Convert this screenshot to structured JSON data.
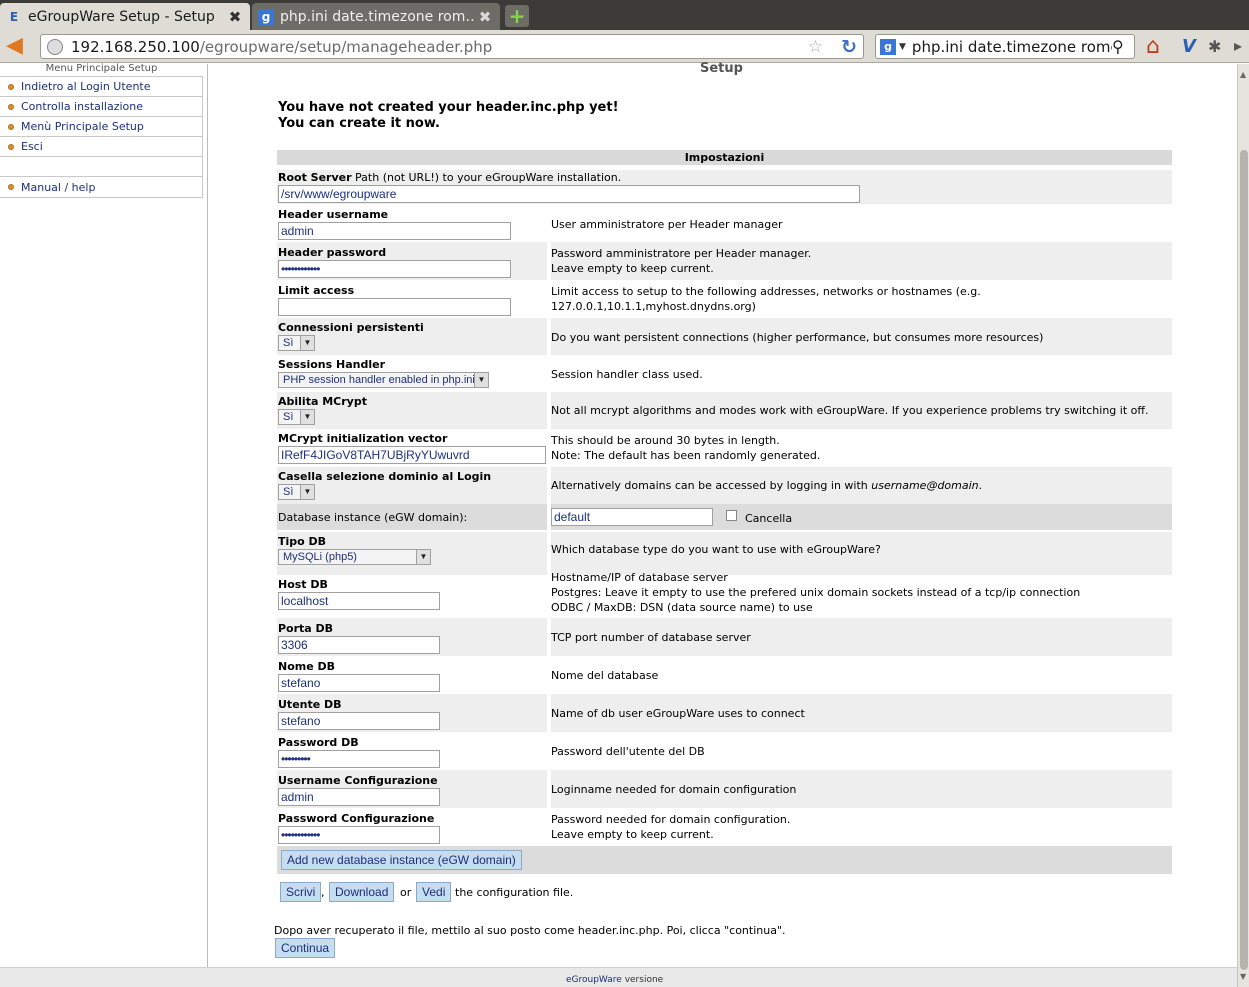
{
  "browser": {
    "tabs": [
      {
        "label": "eGroupWare Setup - Setup",
        "active": true,
        "favicon": "egroupware-icon"
      },
      {
        "label": "php.ini date.timezone rom…",
        "active": false,
        "favicon": "google-icon"
      }
    ],
    "url_host": "192.168.250.100",
    "url_path": "/egroupware/setup/manageheader.php",
    "search_engine": "g",
    "search_query": "php.ini date.timezone rome"
  },
  "sidebar": {
    "title": "Menu Principale Setup",
    "items": [
      {
        "label": "Indietro al Login Utente"
      },
      {
        "label": "Controlla installazione"
      },
      {
        "label": "Menù Principale Setup"
      },
      {
        "label": "Esci"
      },
      {
        "label": ""
      },
      {
        "label": "Manual / help"
      }
    ]
  },
  "page": {
    "heading": "Setup",
    "msg1": "You have not created your header.inc.php yet!",
    "msg2": "You can create it now.",
    "settings_title": "Impostazioni",
    "root_server": {
      "label_bold": "Root Server",
      "label_rest": " Path (not URL!) to your eGroupWare installation.",
      "value": "/srv/www/egroupware"
    },
    "header_username": {
      "label": "Header username",
      "value": "admin",
      "desc": "User amministratore per Header manager"
    },
    "header_password": {
      "label": "Header password",
      "value": "••••••••••••",
      "desc1": "Password amministratore per Header manager.",
      "desc2": "Leave empty to keep current."
    },
    "limit_access": {
      "label": "Limit access",
      "value": "",
      "desc1": "Limit access to setup to the following addresses, networks or hostnames (e.g.",
      "desc2": "127.0.0.1,10.1.1,myhost.dnydns.org)"
    },
    "persistent": {
      "label": "Connessioni persistenti",
      "value": "Sì",
      "desc": "Do you want persistent connections (higher performance, but consumes more resources)"
    },
    "sessions": {
      "label": "Sessions Handler",
      "value": "PHP session handler enabled in php.ini",
      "desc": "Session handler class used."
    },
    "mcrypt": {
      "label": "Abilita MCrypt",
      "value": "Sì",
      "desc": "Not all mcrypt algorithms and modes work with eGroupWare. If you experience problems try switching it off."
    },
    "mcrypt_iv": {
      "label": "MCrypt initialization vector",
      "value": "IRefF4JIGoV8TAH7UBjRyYUwuvrd",
      "desc1": "This should be around 30 bytes in length.",
      "desc2": "Note: The default has been randomly generated."
    },
    "domain_select": {
      "label": "Casella selezione dominio al Login",
      "value": "Sì",
      "desc_pre": "Alternatively domains can be accessed by logging in with ",
      "desc_em": "username@domain",
      "desc_post": "."
    },
    "db_instance": {
      "label": "Database instance (eGW domain):",
      "value": "default",
      "delete_label": "Cancella"
    },
    "db_type": {
      "label": "Tipo DB",
      "value": "MySQLi (php5)",
      "desc": "Which database type do you want to use with eGroupWare?"
    },
    "db_host": {
      "label": "Host DB",
      "value": "localhost",
      "desc1": "Hostname/IP of database server",
      "desc2": "Postgres: Leave it empty to use the prefered unix domain sockets instead of a tcp/ip connection",
      "desc3": "ODBC / MaxDB: DSN (data source name) to use"
    },
    "db_port": {
      "label": "Porta DB",
      "value": "3306",
      "desc": "TCP port number of database server"
    },
    "db_name": {
      "label": "Nome DB",
      "value": "stefano",
      "desc": "Nome del database"
    },
    "db_user": {
      "label": "Utente DB",
      "value": "stefano",
      "desc": "Name of db user eGroupWare uses to connect"
    },
    "db_pass": {
      "label": "Password DB",
      "value": "•••••••••",
      "desc": "Password dell'utente del DB"
    },
    "config_user": {
      "label": "Username Configurazione",
      "value": "admin",
      "desc": "Loginname needed for domain configuration"
    },
    "config_pass": {
      "label": "Password Configurazione",
      "value": "••••••••••••",
      "desc1": "Password needed for domain configuration.",
      "desc2": "Leave empty to keep current."
    },
    "add_instance_label": "Add new database instance (eGW domain)",
    "write_label": "Scrivi",
    "comma": ",",
    "download_label": "Download",
    "or_text": "or",
    "view_label": "Vedi",
    "config_file_text": "the configuration file.",
    "after_text": "Dopo aver recuperato il file, mettilo al suo posto come header.inc.php. Poi, clicca \"continua\".",
    "continue_label": "Continua"
  },
  "footer": {
    "brand": "eGroupWare",
    "version_text": " versione"
  },
  "colors": {
    "link": "#1c2f7d",
    "button_bg": "#c6dcef",
    "row_shade": "#eeeeee",
    "header_shade": "#d9d9d9"
  }
}
